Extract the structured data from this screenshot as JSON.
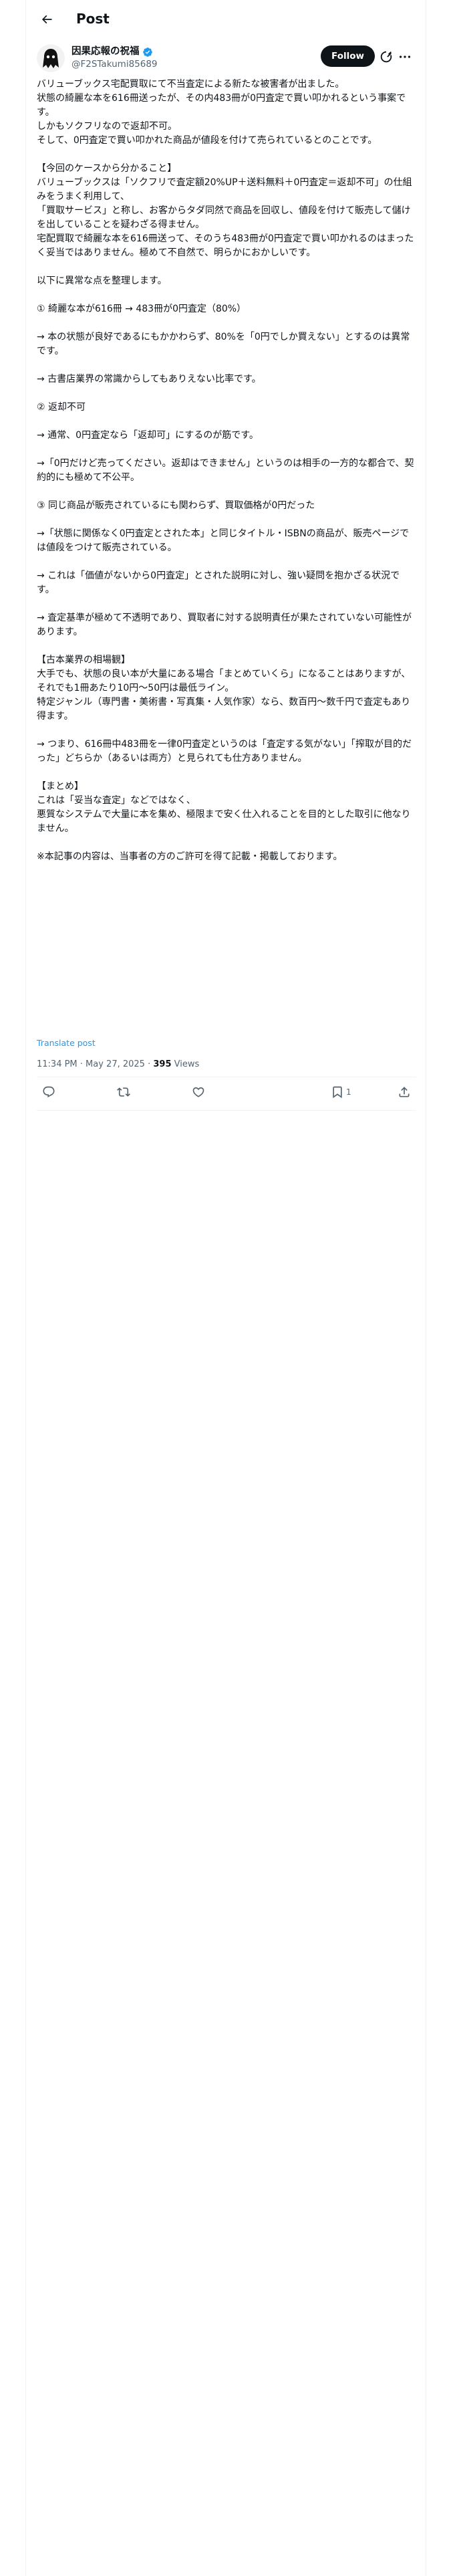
{
  "header": {
    "title": "Post"
  },
  "author": {
    "display_name": "因果応報の祝福",
    "handle": "@F2STakumi85689",
    "follow_label": "Follow"
  },
  "tweet": {
    "text": "バリューブックス宅配買取にて不当査定による新たな被害者が出ました。\n状態の綺麗な本を616冊送ったが、その内483冊が0円査定で買い叩かれるという事案です。\nしかもソクフリなので返却不可。\nそして、0円査定で買い叩かれた商品が値段を付けて売られているとのことです。\n\n【今回のケースから分かること】\nバリューブックスは「ソクフリで査定額20%UP＋送料無料＋0円査定＝返却不可」の仕組みをうまく利用して、\n「買取サービス」と称し、お客からタダ同然で商品を回収し、値段を付けて販売して儲けを出していることを疑わざる得ません。\n宅配買取で綺麗な本を616冊送って、そのうち483冊が0円査定で買い叩かれるのはまったく妥当ではありません。極めて不自然で、明らかにおかしいです。\n\n以下に異常な点を整理します。\n\n① 綺麗な本が616冊 → 483冊が0円査定（80%）\n\n→ 本の状態が良好であるにもかかわらず、80%を「0円でしか買えない」とするのは異常です。\n\n→ 古書店業界の常識からしてもありえない比率です。\n\n② 返却不可\n\n→ 通常、0円査定なら「返却可」にするのが筋です。\n\n→「0円だけど売ってください。返却はできません」というのは相手の一方的な都合で、契約的にも極めて不公平。\n\n③ 同じ商品が販売されているにも関わらず、買取価格が0円だった\n\n→「状態に関係なく0円査定とされた本」と同じタイトル・ISBNの商品が、販売ページでは値段をつけて販売されている。\n\n→ これは「価値がないから0円査定」とされた説明に対し、強い疑問を抱かざる状況です。\n\n→ 査定基準が極めて不透明であり、買取者に対する説明責任が果たされていない可能性があります。\n\n【古本業界の相場観】\n大手でも、状態の良い本が大量にある場合「まとめていくら」になることはありますが、それでも1冊あたり10円〜50円は最低ライン。\n特定ジャンル（専門書・美術書・写真集・人気作家）なら、数百円〜数千円で査定もあり得ます。\n\n→ つまり、616冊中483冊を一律0円査定というのは「査定する気がない」「搾取が目的だった」どちらか（あるいは両方）と見られても仕方ありません。\n\n【まとめ】\nこれは「妥当な査定」などではなく、\n悪質なシステムで大量に本を集め、極限まで安く仕入れることを目的とした取引に他なりません。\n\n※本記事の内容は、当事者の方のご許可を得て記載・掲載しております。",
    "translate_label": "Translate post",
    "time": "11:34 PM · May 27, 2025",
    "separator": " · ",
    "views_count": "395",
    "views_label": " Views"
  },
  "actions": {
    "bookmark_count": "1"
  },
  "icons": {
    "back": "back-arrow-icon",
    "verified": "verified-badge-icon",
    "grok": "grok-icon",
    "more": "more-icon",
    "reply": "reply-icon",
    "repost": "repost-icon",
    "like": "like-icon",
    "bookmark": "bookmark-icon",
    "share": "share-icon"
  },
  "colors": {
    "accent": "#1d9bf0",
    "text": "#0f1419",
    "muted": "#536471",
    "border": "#eff3f4"
  }
}
